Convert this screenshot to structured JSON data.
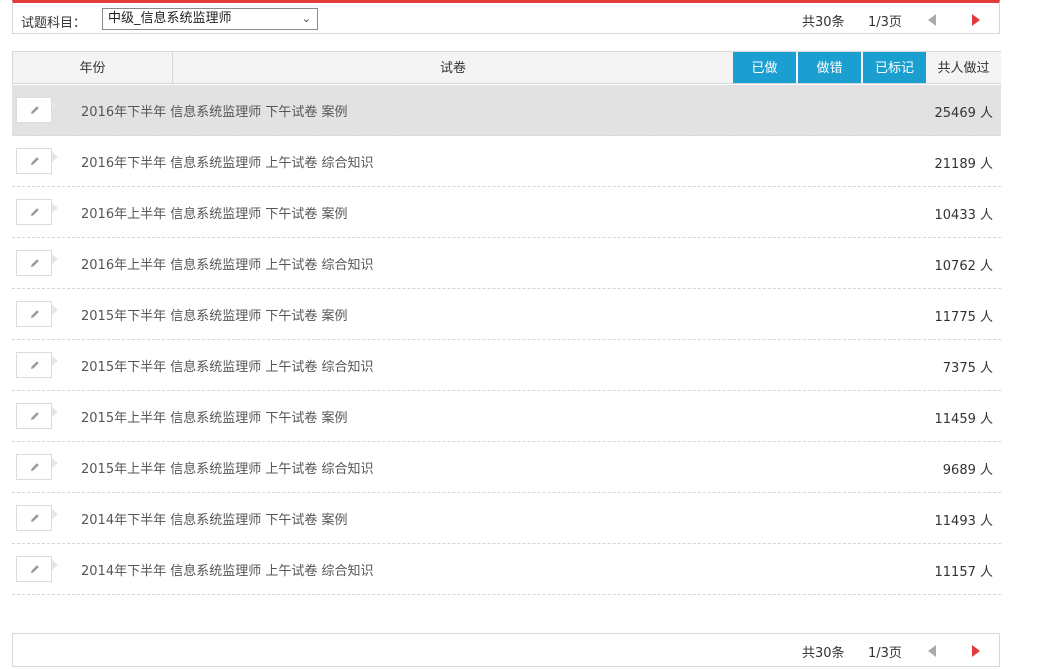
{
  "filter": {
    "label": "试题科目：",
    "selected": "中级_信息系统监理师"
  },
  "pager": {
    "total": "共30条",
    "page": "1/3页"
  },
  "table": {
    "headers": {
      "year": "年份",
      "paper": "试卷",
      "done": "已做",
      "wrong": "做错",
      "marked": "已标记",
      "count": "共人做过"
    },
    "rows": [
      {
        "title": "2016年下半年 信息系统监理师 下午试卷 案例",
        "count": "25469 人"
      },
      {
        "title": "2016年下半年 信息系统监理师 上午试卷 综合知识",
        "count": "21189 人"
      },
      {
        "title": "2016年上半年 信息系统监理师 下午试卷 案例",
        "count": "10433 人"
      },
      {
        "title": "2016年上半年 信息系统监理师 上午试卷 综合知识",
        "count": "10762 人"
      },
      {
        "title": "2015年下半年 信息系统监理师 下午试卷 案例",
        "count": "11775 人"
      },
      {
        "title": "2015年下半年 信息系统监理师 上午试卷 综合知识",
        "count": "7375 人"
      },
      {
        "title": "2015年上半年 信息系统监理师 下午试卷 案例",
        "count": "11459 人"
      },
      {
        "title": "2015年上半年 信息系统监理师 上午试卷 综合知识",
        "count": "9689 人"
      },
      {
        "title": "2014年下半年 信息系统监理师 下午试卷 案例",
        "count": "11493 人"
      },
      {
        "title": "2014年下半年 信息系统监理师 上午试卷 综合知识",
        "count": "11157 人"
      }
    ]
  },
  "colors": {
    "accent": "#1b9ed0",
    "topBorder": "#e23b3b",
    "nextArrow": "#e23b3b",
    "prevArrow": "#aaaaaa",
    "activeRow": "#e2e2e2"
  },
  "icons": {
    "rowAction": "pencil-icon",
    "prev": "prev-arrow-icon",
    "next": "next-arrow-icon",
    "dropdown": "chevron-down-icon"
  }
}
